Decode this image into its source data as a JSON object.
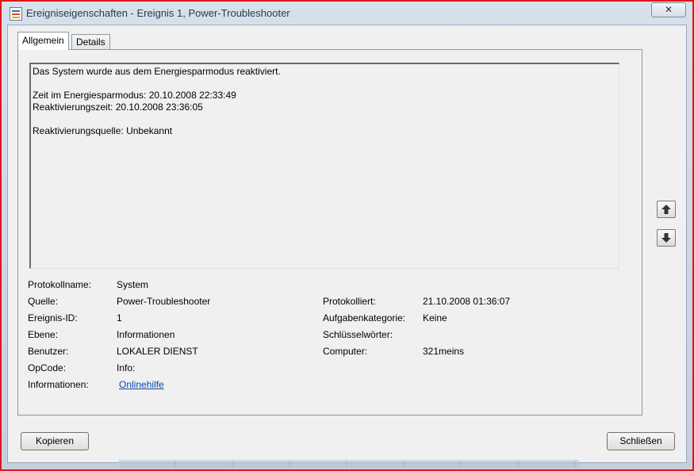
{
  "window": {
    "title": "Ereigniseigenschaften - Ereignis 1, Power-Troubleshooter",
    "close_label": "✕",
    "accent_border": "#e0151b"
  },
  "tabs": [
    {
      "label": "Allgemein",
      "active": true
    },
    {
      "label": "Details",
      "active": false
    }
  ],
  "description": {
    "line1": "Das System wurde aus dem Energiesparmodus reaktiviert.",
    "line2": "Zeit im Energiesparmodus: 20.10.2008 22:33:49",
    "line3": "Reaktivierungszeit: 20.10.2008 23:36:05",
    "line4": "Reaktivierungsquelle: Unbekannt"
  },
  "fields": {
    "protokollname": {
      "label": "Protokollname:",
      "value": "System"
    },
    "quelle": {
      "label": "Quelle:",
      "value": "Power-Troubleshooter"
    },
    "ereignis_id": {
      "label": "Ereignis-ID:",
      "value": "1"
    },
    "ebene": {
      "label": "Ebene:",
      "value": "Informationen"
    },
    "benutzer": {
      "label": "Benutzer:",
      "value": "LOKALER DIENST"
    },
    "opcode": {
      "label": "OpCode:",
      "value": "Info:"
    },
    "informationen": {
      "label": "Informationen:",
      "link": "Onlinehilfe"
    },
    "protokolliert": {
      "label": "Protokolliert:",
      "value": "21.10.2008 01:36:07"
    },
    "aufgabenkategorie": {
      "label": "Aufgabenkategorie:",
      "value": "Keine"
    },
    "schluesselwoerter": {
      "label": "Schlüsselwörter:",
      "value": ""
    },
    "computer": {
      "label": "Computer:",
      "value": "321meins"
    }
  },
  "nav": {
    "up_icon": "arrow-up-icon",
    "down_icon": "arrow-down-icon"
  },
  "buttons": {
    "copy": "Kopieren",
    "close": "Schließen"
  }
}
